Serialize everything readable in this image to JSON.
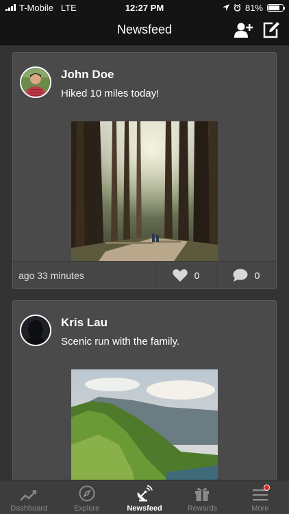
{
  "status": {
    "carrier": "T-Mobile",
    "network": "LTE",
    "time": "12:27 PM",
    "battery": "81%",
    "battery_level": 0.81
  },
  "nav": {
    "title": "Newsfeed",
    "icons": [
      "add-friend-icon",
      "compose-icon"
    ]
  },
  "posts": [
    {
      "author": "John Doe",
      "text": "Hiked 10 miles today!",
      "time": "ago 33 minutes",
      "likes": "0",
      "comments": "0"
    },
    {
      "author": "Kris Lau",
      "text": "Scenic run with the family."
    }
  ],
  "tabs": [
    {
      "label": "Dashboard",
      "icon": "chart-trend-icon"
    },
    {
      "label": "Explore",
      "icon": "compass-icon"
    },
    {
      "label": "Newsfeed",
      "icon": "satellite-dish-icon"
    },
    {
      "label": "Rewards",
      "icon": "gift-icon"
    },
    {
      "label": "More",
      "icon": "menu-icon"
    }
  ],
  "colors": {
    "background": "#333333",
    "card": "#4a4a4a",
    "bar": "#141414",
    "badge": "#e8211b"
  }
}
